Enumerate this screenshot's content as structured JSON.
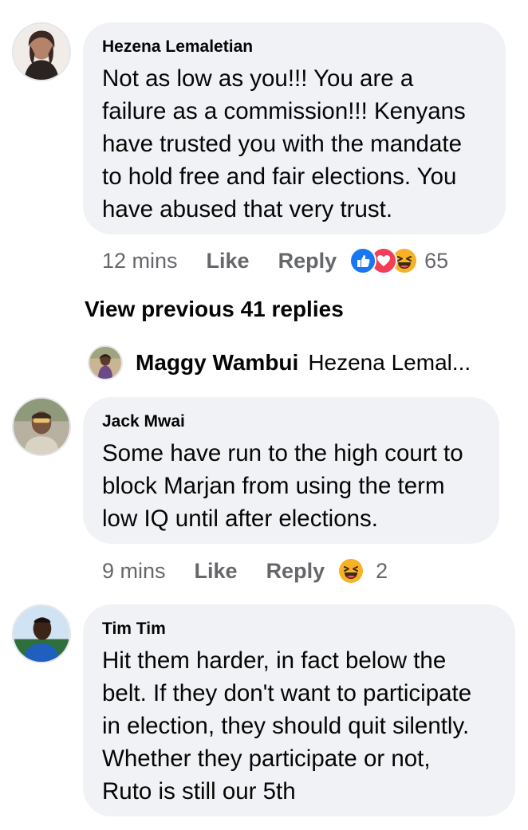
{
  "comments": [
    {
      "author": "Hezena Lemaletian",
      "text": "Not as low as you!!! You are a\nfailure as a commission!!! Kenyans\nhave trusted you with the mandate\nto hold free and fair elections. You\nhave abused that very trust.",
      "time": "12 mins",
      "like_label": "Like",
      "reply_label": "Reply",
      "reactions": [
        "like-icon",
        "love-icon",
        "haha-icon"
      ],
      "reaction_count": "65"
    },
    {
      "author": "Jack Mwai",
      "text": "Some have run to the high court to\nblock Marjan from using the term\nlow IQ until after elections.",
      "time": "9 mins",
      "like_label": "Like",
      "reply_label": "Reply",
      "reactions": [
        "haha-icon"
      ],
      "reaction_count": "2"
    },
    {
      "author": "Tim Tim",
      "text": "Hit them harder, in fact below the\nbelt. If they don't want to participate\nin election, they should quit silently.\nWhether they participate or not,\nRuto is still our 5th"
    }
  ],
  "view_previous": "View previous 41 replies",
  "reply_preview": {
    "name": "Maggy Wambui",
    "snippet": "Hezena Lemal..."
  },
  "colors": {
    "bubble": "#f0f2f5",
    "meta_text": "#65676b",
    "like_blue": "#1877f2",
    "love_red": "#f33e58",
    "haha_yellow": "#f7b125"
  }
}
